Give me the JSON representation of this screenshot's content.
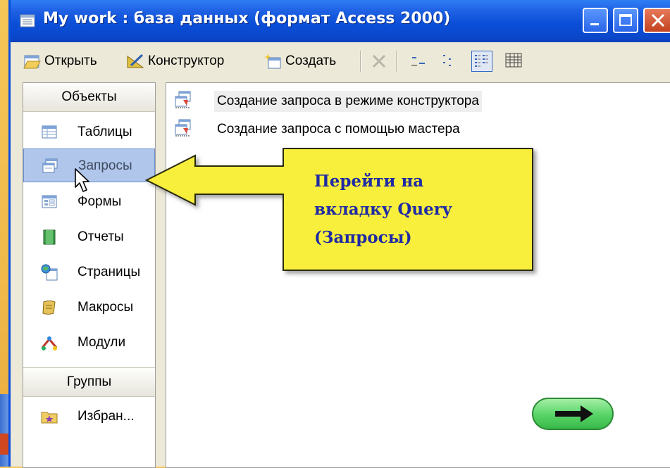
{
  "window": {
    "title": "My work : база данных (формат Access 2000)"
  },
  "toolbar": {
    "open_label": "Открыть",
    "design_label": "Конструктор",
    "create_label": "Создать"
  },
  "sidebar": {
    "objects_header": "Объекты",
    "items": [
      {
        "label": "Таблицы",
        "icon": "table-icon"
      },
      {
        "label": "Запросы",
        "icon": "query-icon",
        "selected": true
      },
      {
        "label": "Формы",
        "icon": "form-icon"
      },
      {
        "label": "Отчеты",
        "icon": "report-icon"
      },
      {
        "label": "Страницы",
        "icon": "page-icon"
      },
      {
        "label": "Макросы",
        "icon": "macro-icon"
      },
      {
        "label": "Модули",
        "icon": "module-icon"
      }
    ],
    "groups_header": "Группы",
    "groups": [
      {
        "label": "Избран...",
        "icon": "favorites-folder-icon"
      }
    ]
  },
  "content": {
    "items": [
      {
        "label": "Создание запроса в режиме конструктора",
        "icon": "new-query-icon"
      },
      {
        "label": "Создание запроса с помощью мастера",
        "icon": "new-query-icon"
      }
    ]
  },
  "callout": {
    "text": "Перейти на\nвкладку Query\n(Запросы)",
    "fill_color": "#f7ef3a",
    "text_color": "#1f2aa5"
  },
  "colors": {
    "titlebar": "#0a4ee0",
    "selection": "#b0c6ea",
    "next_button": "#5cd66a"
  }
}
